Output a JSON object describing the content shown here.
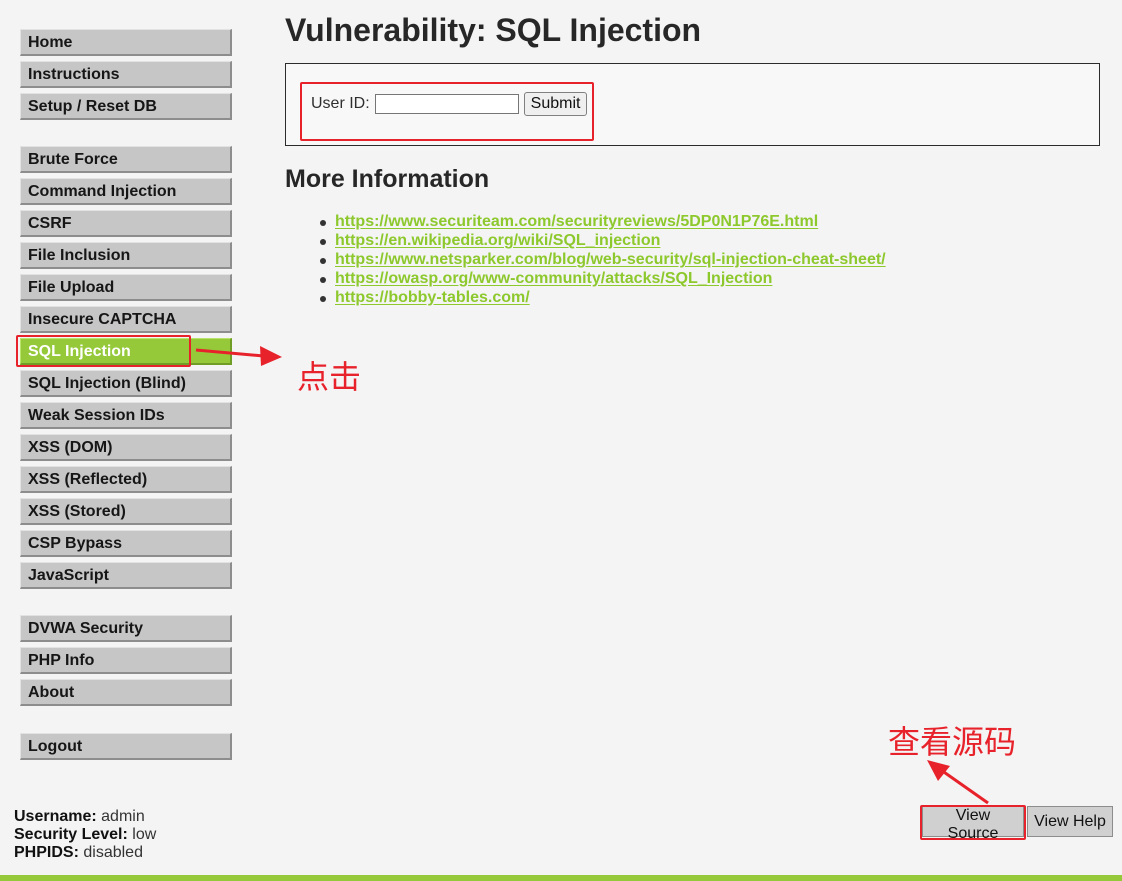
{
  "sidebar": {
    "group1": [
      {
        "label": "Home"
      },
      {
        "label": "Instructions"
      },
      {
        "label": "Setup / Reset DB"
      }
    ],
    "group2": [
      {
        "label": "Brute Force"
      },
      {
        "label": "Command Injection"
      },
      {
        "label": "CSRF"
      },
      {
        "label": "File Inclusion"
      },
      {
        "label": "File Upload"
      },
      {
        "label": "Insecure CAPTCHA"
      },
      {
        "label": "SQL Injection",
        "selected": true
      },
      {
        "label": "SQL Injection (Blind)"
      },
      {
        "label": "Weak Session IDs"
      },
      {
        "label": "XSS (DOM)"
      },
      {
        "label": "XSS (Reflected)"
      },
      {
        "label": "XSS (Stored)"
      },
      {
        "label": "CSP Bypass"
      },
      {
        "label": "JavaScript"
      }
    ],
    "group3": [
      {
        "label": "DVWA Security"
      },
      {
        "label": "PHP Info"
      },
      {
        "label": "About"
      }
    ],
    "group4": [
      {
        "label": "Logout"
      }
    ]
  },
  "main": {
    "title": "Vulnerability: SQL Injection",
    "form": {
      "user_id_label": "User ID:",
      "user_id_value": "",
      "submit_label": "Submit"
    },
    "more_info_heading": "More Information",
    "links": [
      "https://www.securiteam.com/securityreviews/5DP0N1P76E.html",
      "https://en.wikipedia.org/wiki/SQL_injection",
      "https://www.netsparker.com/blog/web-security/sql-injection-cheat-sheet/",
      "https://owasp.org/www-community/attacks/SQL_Injection",
      "https://bobby-tables.com/"
    ]
  },
  "footer": {
    "username_label": "Username:",
    "username_value": "admin",
    "security_level_label": "Security Level:",
    "security_level_value": "low",
    "phpids_label": "PHPIDS:",
    "phpids_value": "disabled",
    "view_source_label": "View Source",
    "view_help_label": "View Help"
  },
  "annotations": {
    "click_note": "点击",
    "view_source_note": "查看源码"
  },
  "colors": {
    "accent_green": "#95c939",
    "link_green": "#8dc82d",
    "annotation_red": "#e8222b",
    "menu_gray": "#c6c6c6"
  }
}
